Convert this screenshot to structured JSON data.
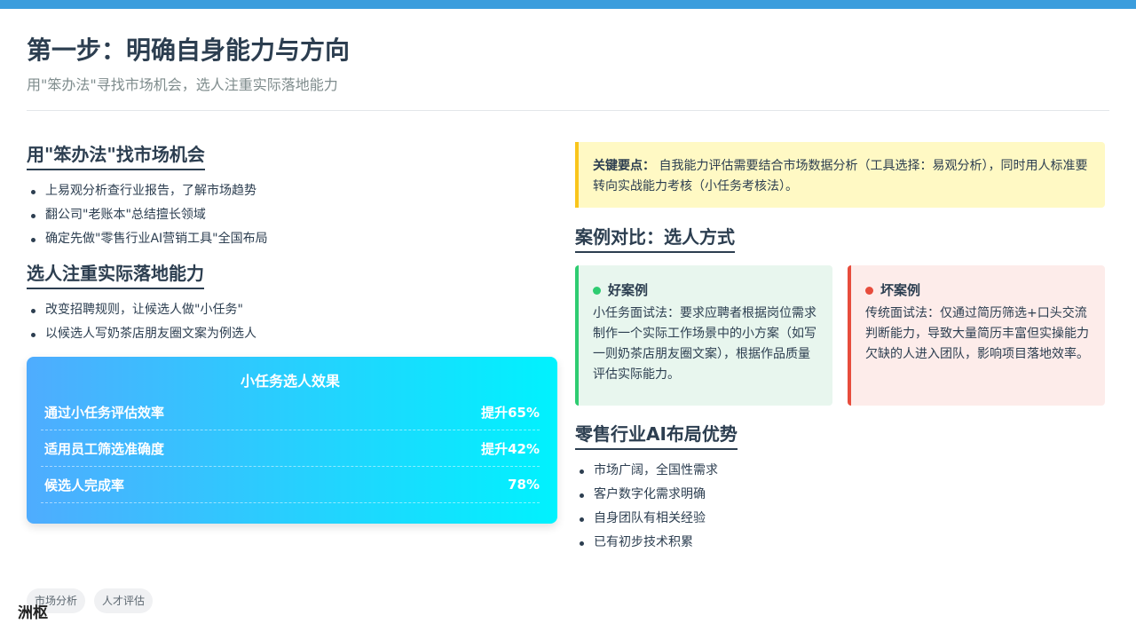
{
  "header": {
    "title": "第一步：明确自身能力与方向",
    "subtitle": "用\"笨办法\"寻找市场机会，选人注重实际落地能力"
  },
  "left": {
    "section1": {
      "title": "用\"笨办法\"找市场机会",
      "items": [
        "上易观分析查行业报告，了解市场趋势",
        "翻公司\"老账本\"总结擅长领域",
        "确定先做\"零售行业AI营销工具\"全国布局"
      ]
    },
    "section2": {
      "title": "选人注重实际落地能力",
      "items": [
        "改变招聘规则，让候选人做\"小任务\"",
        "以候选人写奶茶店朋友圈文案为例选人"
      ]
    },
    "effect": {
      "title": "小任务选人效果",
      "metrics": [
        {
          "label": "通过小任务评估效率",
          "value": "提升65%"
        },
        {
          "label": "适用员工筛选准确度",
          "value": "提升42%"
        },
        {
          "label": "候选人完成率",
          "value": "78%"
        }
      ]
    }
  },
  "right": {
    "keypoint": {
      "label": "关键要点：",
      "text": "自我能力评估需要结合市场数据分析（工具选择：易观分析），同时用人标准要转向实战能力考核（小任务考核法）。"
    },
    "cases_title": "案例对比：选人方式",
    "good": {
      "title": "好案例",
      "text": "小任务面试法：要求应聘者根据岗位需求制作一个实际工作场景中的小方案（如写一则奶茶店朋友圈文案），根据作品质量评估实际能力。"
    },
    "bad": {
      "title": "坏案例",
      "text": "传统面试法：仅通过简历筛选+口头交流判断能力，导致大量简历丰富但实操能力欠缺的人进入团队，影响项目落地效率。"
    },
    "section3": {
      "title": "零售行业AI布局优势",
      "items": [
        "市场广阔，全国性需求",
        "客户数字化需求明确",
        "自身团队有相关经验",
        "已有初步技术积累"
      ]
    }
  },
  "footer": {
    "tags": [
      "市场分析",
      "人才评估"
    ],
    "brand": "洲枢"
  },
  "colors": {
    "accent": "#3b9ddd",
    "good": "#2ecc71",
    "bad": "#e74c3c",
    "highlight": "#f9c51b"
  }
}
